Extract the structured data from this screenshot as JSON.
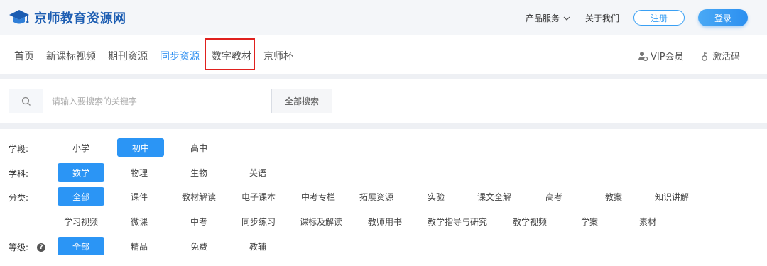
{
  "header": {
    "logo_text": "京师教育资源网",
    "links": [
      {
        "label": "产品服务",
        "icon": "chevron-down-icon"
      },
      {
        "label": "关于我们"
      }
    ],
    "register_label": "注册",
    "login_label": "登录"
  },
  "nav": {
    "items": [
      {
        "label": "首页",
        "active": false
      },
      {
        "label": "新课标视频",
        "active": false
      },
      {
        "label": "期刊资源",
        "active": false
      },
      {
        "label": "同步资源",
        "active": true
      },
      {
        "label": "数字教材",
        "active": false,
        "highlighted": true
      },
      {
        "label": "京师杯",
        "active": false
      }
    ],
    "right": [
      {
        "label": "VIP会员",
        "icon": "vip-user-icon"
      },
      {
        "label": "激活码",
        "icon": "key-icon"
      }
    ],
    "highlight_color": "#e0211e"
  },
  "search": {
    "placeholder": "请输入要搜索的关键字",
    "button_label": "全部搜索"
  },
  "filters": {
    "stage": {
      "label": "学段:",
      "options": [
        "小学",
        "初中",
        "高中"
      ],
      "selected": "初中"
    },
    "subject": {
      "label": "学科:",
      "options": [
        "数学",
        "物理",
        "生物",
        "英语"
      ],
      "selected": "数学"
    },
    "category": {
      "label": "分类:",
      "row1": [
        "全部",
        "课件",
        "教材解读",
        "电子课本",
        "中考专栏",
        "拓展资源",
        "实验",
        "课文全解",
        "高考",
        "教案",
        "知识讲解"
      ],
      "row2": [
        "学习视频",
        "微课",
        "中考",
        "同步练习",
        "课标及解读",
        "教师用书",
        "教学指导与研究",
        "教学视频",
        "学案",
        "素材"
      ],
      "selected": "全部"
    },
    "level": {
      "label": "等级:",
      "help_icon": "question-icon",
      "options": [
        "全部",
        "精品",
        "免费",
        "教辅"
      ],
      "selected": "全部"
    }
  },
  "colors": {
    "accent": "#2b95f5",
    "brand": "#1c5db2",
    "active_nav": "#2f8ff0"
  }
}
